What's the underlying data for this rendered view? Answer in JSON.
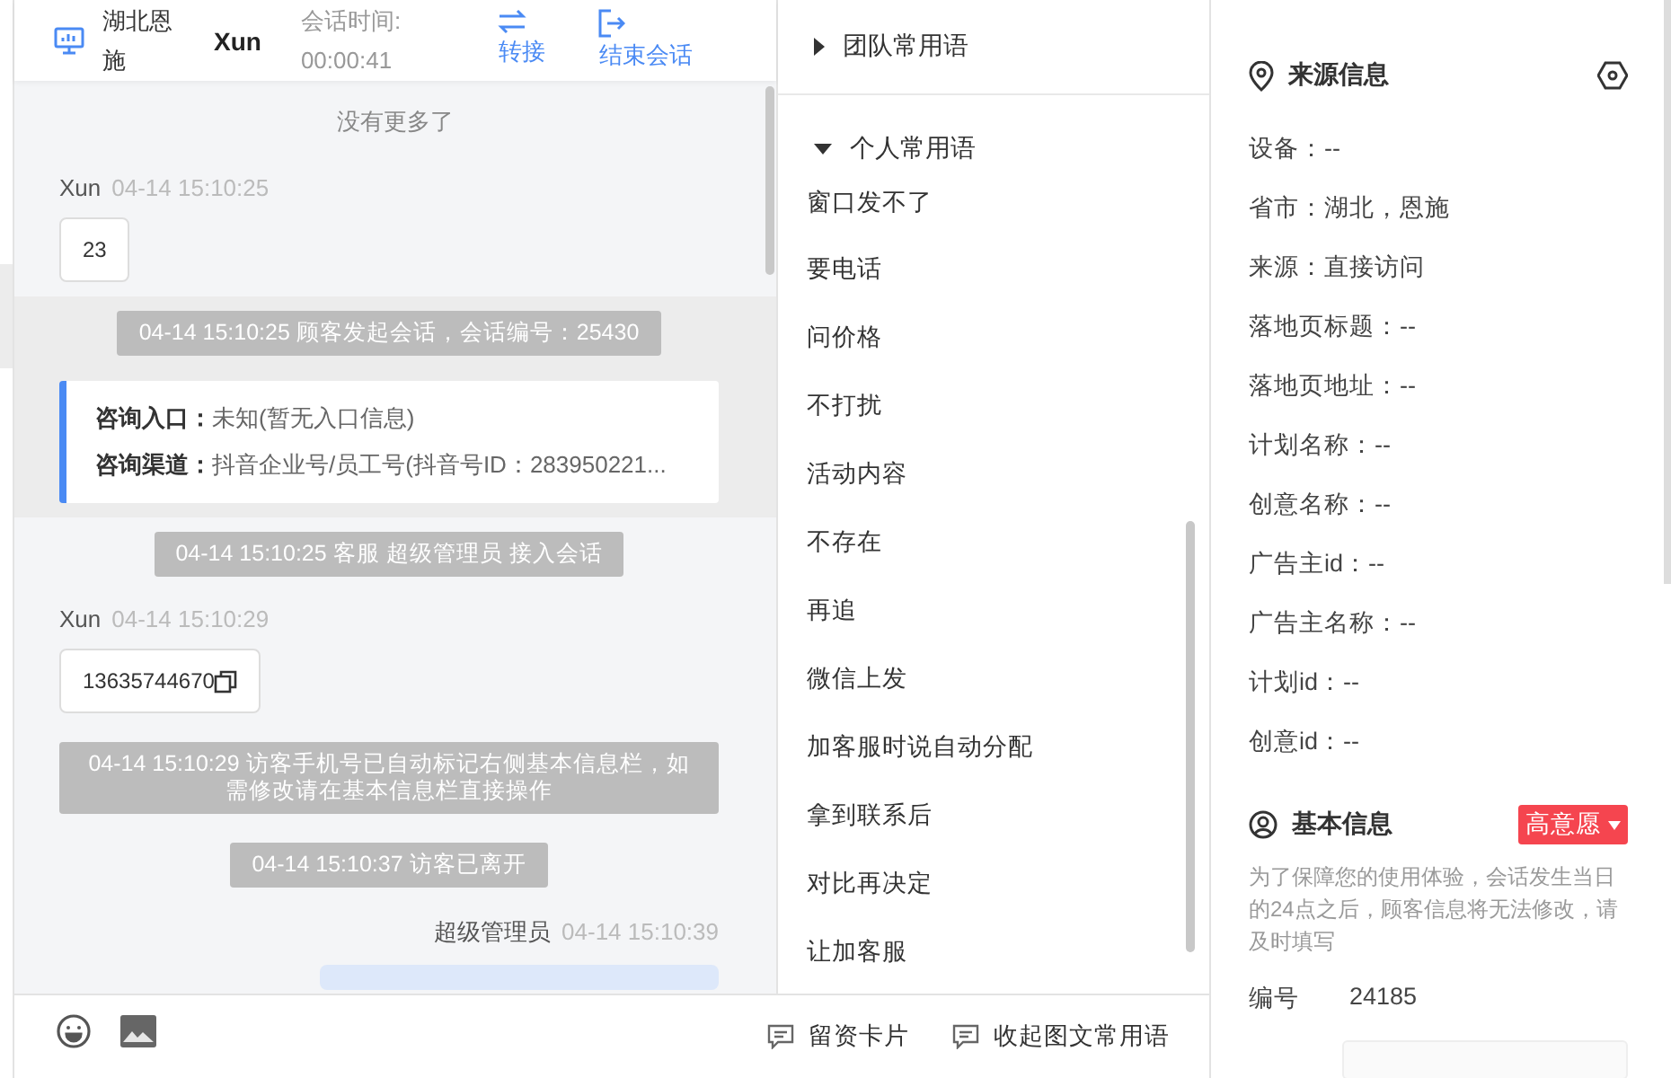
{
  "header": {
    "location": "湖北恩施",
    "visitor": "Xun",
    "timer_label": "会话时间:",
    "timer": "00:00:41",
    "actions": [
      {
        "kind": "transfer",
        "label": "转接"
      },
      {
        "kind": "end",
        "label": "结束会话"
      }
    ]
  },
  "chat": {
    "no_more": "没有更多了",
    "messages": [
      {
        "kind": "visitor",
        "sender": "Xun",
        "time": "04-14 15:10:25",
        "text": "23",
        "copyable": false
      },
      {
        "kind": "session_start",
        "text": "04-14 15:10:25 顾客发起会话，会话编号：25430",
        "rows": [
          {
            "label": "咨询入口：",
            "value": "未知(暂无入口信息)"
          },
          {
            "label": "咨询渠道：",
            "value": "抖音企业号/员工号(抖音号ID：283950221..."
          }
        ]
      },
      {
        "kind": "system",
        "text": "04-14 15:10:25 客服 超级管理员 接入会话"
      },
      {
        "kind": "visitor",
        "sender": "Xun",
        "time": "04-14 15:10:29",
        "text": "13635744670",
        "copyable": true
      },
      {
        "kind": "system",
        "text": "04-14 15:10:29 访客手机号已自动标记右侧基本信息栏，如需修改请在基本信息栏直接操作"
      },
      {
        "kind": "system",
        "text": "04-14 15:10:37 访客已离开"
      },
      {
        "kind": "agent",
        "sender": "超级管理员",
        "time": "04-14 15:10:39"
      }
    ]
  },
  "phrases": {
    "groups": [
      {
        "title": "团队常用语",
        "expanded": false
      },
      {
        "title": "个人常用语",
        "expanded": true,
        "items": [
          "窗口发不了",
          "要电话",
          "问价格",
          "不打扰",
          "活动内容",
          "不存在",
          "再追",
          "微信上发",
          "加客服时说自动分配",
          "拿到联系后",
          "对比再决定",
          "让加客服"
        ]
      }
    ]
  },
  "footer": {
    "actions": [
      "留资卡片",
      "收起图文常用语"
    ]
  },
  "source_info": {
    "title": "来源信息",
    "fields": [
      "设备：--",
      "省市：湖北，恩施",
      "来源：直接访问",
      "落地页标题：--",
      "落地页地址：--",
      "计划名称：--",
      "创意名称：--",
      "广告主id：--",
      "广告主名称：--",
      "计划id：--",
      "创意id：--"
    ]
  },
  "basic_info": {
    "title": "基本信息",
    "intent": {
      "label": "高意愿",
      "color": "#f5454f"
    },
    "note": "为了保障您的使用体验，会话发生当日的24点之后，顾客信息将无法修改，请及时填写",
    "fields": [
      {
        "label": "编号",
        "value": "24185"
      }
    ]
  }
}
